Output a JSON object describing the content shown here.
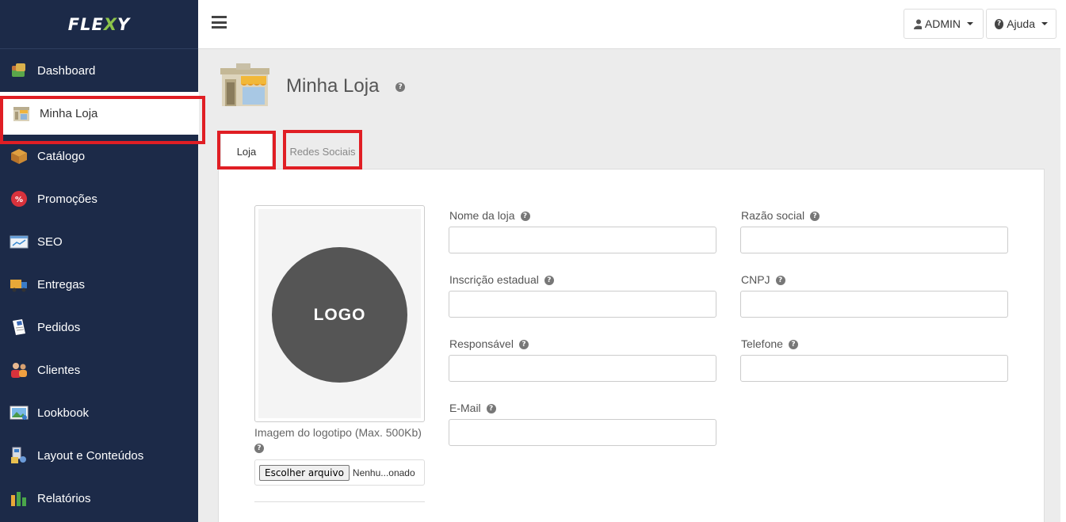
{
  "brand": {
    "name_a": "FLE",
    "name_x": "X",
    "name_b": "Y"
  },
  "sidebar": {
    "items": [
      {
        "label": "Dashboard",
        "icon": "dashboard-icon"
      },
      {
        "label": "Minha Loja",
        "icon": "store-icon"
      },
      {
        "label": "Catálogo",
        "icon": "box-icon"
      },
      {
        "label": "Promoções",
        "icon": "percent-icon"
      },
      {
        "label": "SEO",
        "icon": "seo-chart-icon"
      },
      {
        "label": "Entregas",
        "icon": "truck-icon"
      },
      {
        "label": "Pedidos",
        "icon": "document-icon"
      },
      {
        "label": "Clientes",
        "icon": "users-icon"
      },
      {
        "label": "Lookbook",
        "icon": "picture-icon"
      },
      {
        "label": "Layout e Conteúdos",
        "icon": "layout-icon"
      },
      {
        "label": "Relatórios",
        "icon": "bar-chart-icon"
      }
    ]
  },
  "topbar": {
    "admin_label": "ADMIN",
    "help_label": "Ajuda"
  },
  "page": {
    "title": "Minha Loja"
  },
  "tabs": {
    "loja": "Loja",
    "redes": "Redes Sociais"
  },
  "logo": {
    "circle_text": "LOGO",
    "caption": "Imagem do logotipo (Max. 500Kb)",
    "file_button": "Escolher arquivo",
    "file_status": "Nenhu...onado"
  },
  "form": {
    "nome": {
      "label": "Nome da loja",
      "value": ""
    },
    "razao": {
      "label": "Razão social",
      "value": ""
    },
    "inscricao": {
      "label": "Inscrição estadual",
      "value": ""
    },
    "cnpj": {
      "label": "CNPJ",
      "value": ""
    },
    "responsavel": {
      "label": "Responsável",
      "value": ""
    },
    "telefone": {
      "label": "Telefone",
      "value": ""
    },
    "email": {
      "label": "E-Mail",
      "value": ""
    }
  },
  "colors": {
    "sidebar_bg": "#1c2a48",
    "highlight": "#e01e24",
    "brand_x": "#8bc34a"
  }
}
